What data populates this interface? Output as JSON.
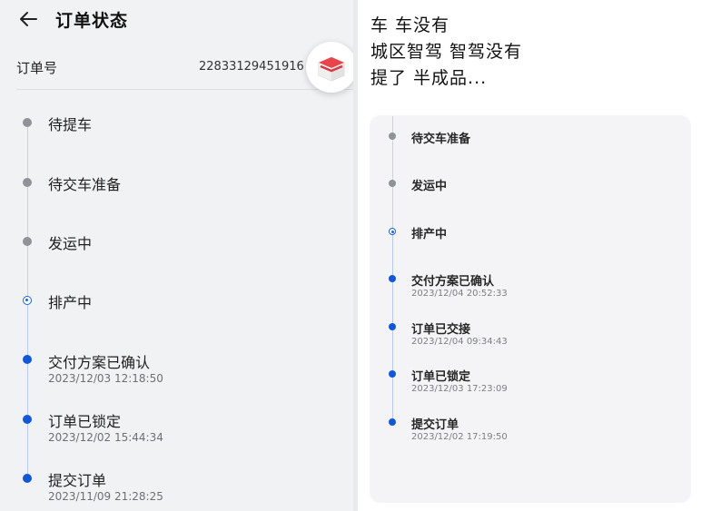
{
  "left": {
    "title": "订单状态",
    "order_label": "订单号",
    "order_number": "22833129451916",
    "steps": [
      {
        "label": "待提车",
        "time": ""
      },
      {
        "label": "待交车准备",
        "time": ""
      },
      {
        "label": "发运中",
        "time": ""
      },
      {
        "label": "排产中",
        "time": ""
      },
      {
        "label": "交付方案已确认",
        "time": "2023/12/03 12:18:50"
      },
      {
        "label": "订单已锁定",
        "time": "2023/12/02 15:44:34"
      },
      {
        "label": "提交订单",
        "time": "2023/11/09 21:28:25"
      }
    ]
  },
  "right": {
    "caption_lines": [
      "车 车没有",
      "城区智驾 智驾没有",
      "提了 半成品..."
    ],
    "steps": [
      {
        "label": "待交车准备",
        "time": ""
      },
      {
        "label": "发运中",
        "time": ""
      },
      {
        "label": "排产中",
        "time": ""
      },
      {
        "label": "交付方案已确认",
        "time": "2023/12/04 20:52:33"
      },
      {
        "label": "订单已交接",
        "time": "2023/12/04 09:34:43"
      },
      {
        "label": "订单已锁定",
        "time": "2023/12/03 17:23:09"
      },
      {
        "label": "提交订单",
        "time": "2023/12/02 17:19:50"
      }
    ]
  },
  "icons": {
    "back": "arrow-left-icon",
    "float": "gift-box-icon"
  },
  "colors": {
    "accent_blue": "#1258d6",
    "pending_gray": "#8f9296",
    "panel_bg": "#f1f2f4"
  }
}
